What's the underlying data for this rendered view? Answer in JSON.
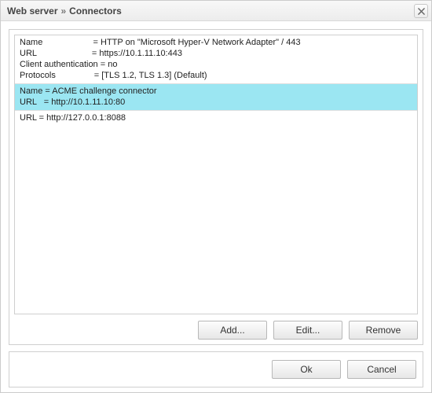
{
  "title": {
    "crumb1": "Web server",
    "sep": "»",
    "crumb2": "Connectors"
  },
  "entries": [
    {
      "selected": false,
      "lines": [
        "Name                     = HTTP on \"Microsoft Hyper-V Network Adapter\" / 443",
        "URL                       = https://10.1.11.10:443",
        "Client authentication = no",
        "Protocols                = [TLS 1.2, TLS 1.3] (Default)"
      ]
    },
    {
      "selected": true,
      "lines": [
        "Name = ACME challenge connector",
        "URL   = http://10.1.11.10:80"
      ]
    },
    {
      "selected": false,
      "lines": [
        "URL = http://127.0.0.1:8088"
      ]
    }
  ],
  "buttons": {
    "add": "Add...",
    "edit": "Edit...",
    "remove": "Remove"
  },
  "footer": {
    "ok": "Ok",
    "cancel": "Cancel"
  }
}
